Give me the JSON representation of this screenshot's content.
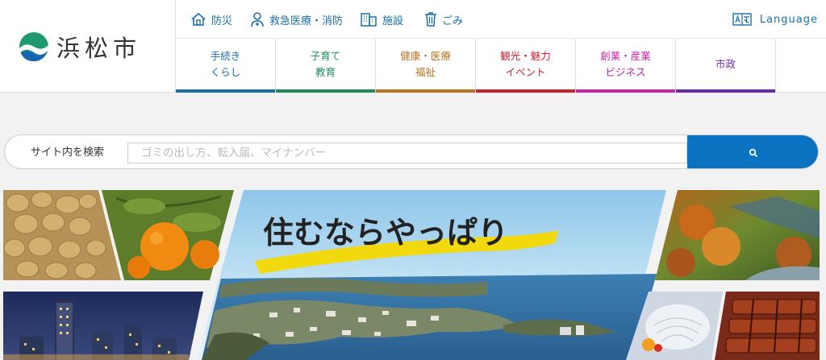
{
  "site": {
    "logo_text": "浜松市"
  },
  "utility": {
    "items": [
      {
        "label": "防災",
        "icon": "house-icon"
      },
      {
        "label": "救急医療・消防",
        "icon": "medic-icon"
      },
      {
        "label": "施設",
        "icon": "building-icon"
      },
      {
        "label": "ごみ",
        "icon": "trash-icon"
      }
    ],
    "language_label": "Language"
  },
  "nav": {
    "items": [
      {
        "label": "手続き\nくらし",
        "color": "#1a6fa8"
      },
      {
        "label": "子育て\n教育",
        "color": "#1f8a5a"
      },
      {
        "label": "健康・医療\n福祉",
        "color": "#b8711f"
      },
      {
        "label": "観光・魅力\nイベント",
        "color": "#c8202f"
      },
      {
        "label": "創業・産業\nビジネス",
        "color": "#c424a8"
      },
      {
        "label": "市政",
        "color": "#6a2aa8"
      }
    ]
  },
  "search": {
    "label": "サイト内を検索",
    "placeholder": "ゴミの出し方、転入届、マイナンバー",
    "button_icon": "search-icon"
  },
  "banner": {
    "headline": "住むならやっぱり"
  },
  "colors": {
    "accent": "#0b72c2",
    "link": "#1a6fa8"
  }
}
